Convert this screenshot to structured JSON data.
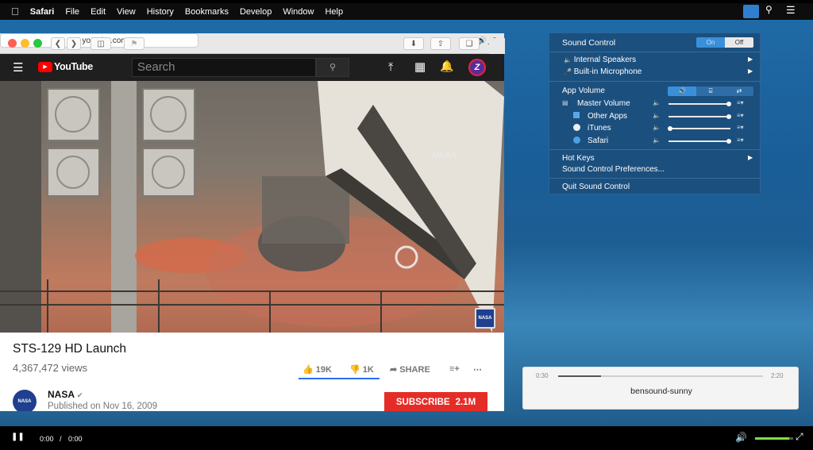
{
  "menubar": {
    "items": [
      "Safari",
      "File",
      "Edit",
      "View",
      "History",
      "Bookmarks",
      "Develop",
      "Window",
      "Help"
    ]
  },
  "safari": {
    "url": "youtube.com"
  },
  "youtube": {
    "logo_text": "YouTube",
    "search_placeholder": "Search",
    "avatar_letter": "Z",
    "video": {
      "title": "STS-129 HD Launch",
      "views": "4,367,472 views",
      "likes": "19K",
      "dislikes": "1K",
      "share_label": "SHARE",
      "channel": "NASA",
      "published": "Published on Nov 16, 2009",
      "subscribe_label": "SUBSCRIBE",
      "subscribers": "2.1M",
      "overlay_text": "NASA",
      "watermark_text": "NASA"
    }
  },
  "sound_control": {
    "title": "Sound Control",
    "toggle_on": "On",
    "toggle_off": "Off",
    "devices": [
      "Internal Speakers",
      "Built-in Microphone"
    ],
    "app_volume_label": "App Volume",
    "apps": [
      {
        "name": "Master Volume",
        "level": 0.97
      },
      {
        "name": "Other Apps",
        "level": 0.97
      },
      {
        "name": "iTunes",
        "level": 0.02
      },
      {
        "name": "Safari",
        "level": 0.97
      }
    ],
    "hot_keys": "Hot Keys",
    "preferences": "Sound Control Preferences...",
    "quit": "Quit Sound Control"
  },
  "player": {
    "time_elapsed": "0:30",
    "time_total": "2:20",
    "progress": 0.21,
    "track": "bensound-sunny"
  },
  "video_controls": {
    "current": "0:00",
    "separator": "/",
    "duration": "0:00",
    "volume": 0.9
  },
  "colors": {
    "accent_red": "#e52d27",
    "panel_blue": "#1b4f7e",
    "toggle_on_blue": "#3a8fd9"
  }
}
